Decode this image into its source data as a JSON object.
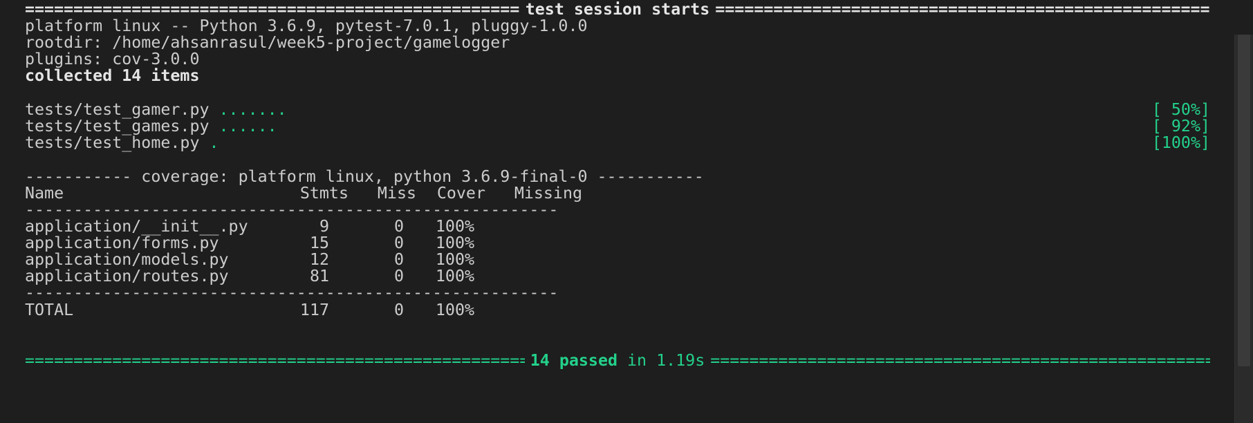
{
  "header": {
    "title": "test session starts"
  },
  "session": {
    "platform": "platform linux -- Python 3.6.9, pytest-7.0.1, pluggy-1.0.0",
    "rootdir": "rootdir: /home/ahsanrasul/week5-project/gamelogger",
    "plugins": "plugins: cov-3.0.0",
    "collected": "collected 14 items"
  },
  "tests": [
    {
      "file": "tests/test_gamer.py ",
      "dots": ".......",
      "percent": "[ 50%]"
    },
    {
      "file": "tests/test_games.py ",
      "dots": "......",
      "percent": "[ 92%]"
    },
    {
      "file": "tests/test_home.py ",
      "dots": ".",
      "percent": "[100%]"
    }
  ],
  "coverage": {
    "title": "----------- coverage: platform linux, python 3.6.9-final-0 -----------",
    "columns": {
      "name": "Name",
      "stmts": "Stmts",
      "miss": "Miss",
      "cover": "Cover",
      "missing": "Missing"
    },
    "rule": "-------------------------------------------------------",
    "rows": [
      {
        "name": "application/__init__.py",
        "stmts": "9",
        "miss": "0",
        "cover": "100%",
        "missing": ""
      },
      {
        "name": "application/forms.py",
        "stmts": "15",
        "miss": "0",
        "cover": "100%",
        "missing": ""
      },
      {
        "name": "application/models.py",
        "stmts": "12",
        "miss": "0",
        "cover": "100%",
        "missing": ""
      },
      {
        "name": "application/routes.py",
        "stmts": "81",
        "miss": "0",
        "cover": "100%",
        "missing": ""
      }
    ],
    "total": {
      "name": "TOTAL",
      "stmts": "117",
      "miss": "0",
      "cover": "100%",
      "missing": ""
    }
  },
  "summary": {
    "passed": "14 passed",
    "time": "in 1.19s"
  },
  "colors": {
    "background": "#1e1e1e",
    "text": "#cccccc",
    "pass_green": "#23d18b"
  }
}
